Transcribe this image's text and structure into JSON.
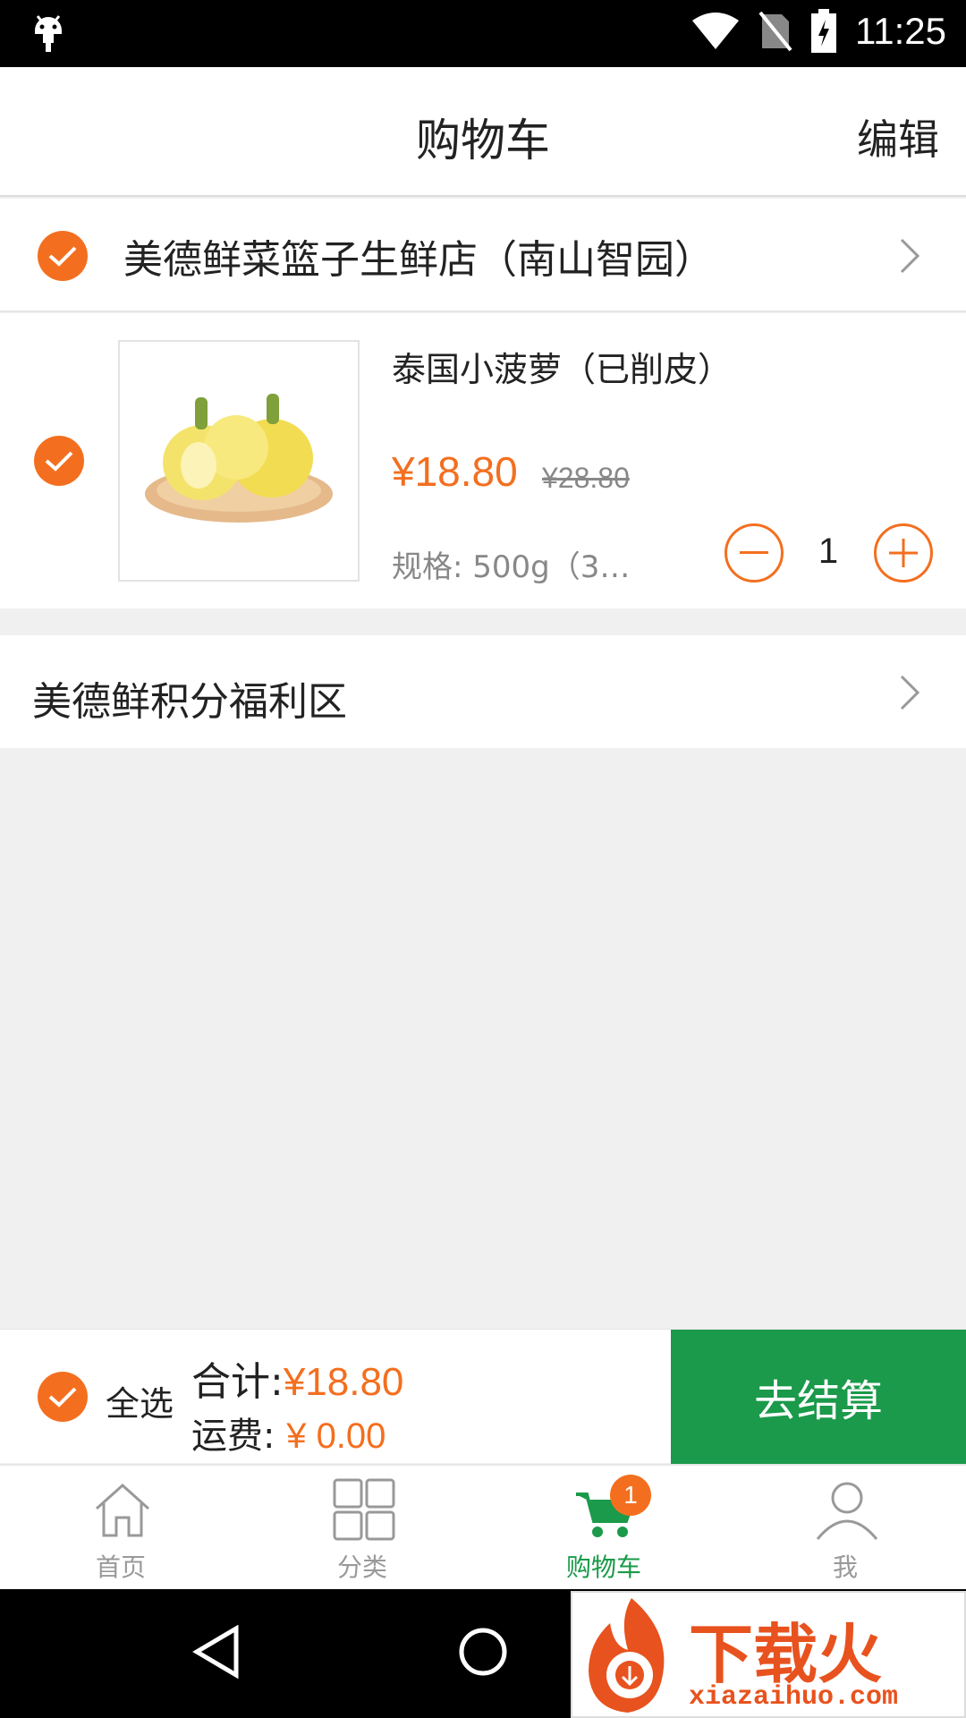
{
  "status_bar": {
    "time": "11:25"
  },
  "header": {
    "title": "购物车",
    "edit": "编辑"
  },
  "store": {
    "name": "美德鲜菜篮子生鲜店（南山智园）"
  },
  "item": {
    "name": "泰国小菠萝（已削皮）",
    "price": "¥18.80",
    "original_price": "¥28.80",
    "spec": "规格: 500g（3~…",
    "quantity": "1"
  },
  "points_zone": {
    "label": "美德鲜积分福利区"
  },
  "checkout": {
    "select_all": "全选",
    "total_label": "合计:",
    "total_value": "¥18.80",
    "shipping_label": "运费:",
    "shipping_value": "¥ 0.00",
    "button": "去结算"
  },
  "tabs": [
    {
      "label": "首页",
      "icon": "home-icon"
    },
    {
      "label": "分类",
      "icon": "category-grid-icon"
    },
    {
      "label": "购物车",
      "icon": "cart-icon",
      "badge": "1"
    },
    {
      "label": "我",
      "icon": "person-icon"
    }
  ],
  "watermark": {
    "text": "下载火",
    "url": "xiazaihuo.com"
  },
  "colors": {
    "accent": "#f36f1f",
    "green": "#1a9a4a"
  }
}
